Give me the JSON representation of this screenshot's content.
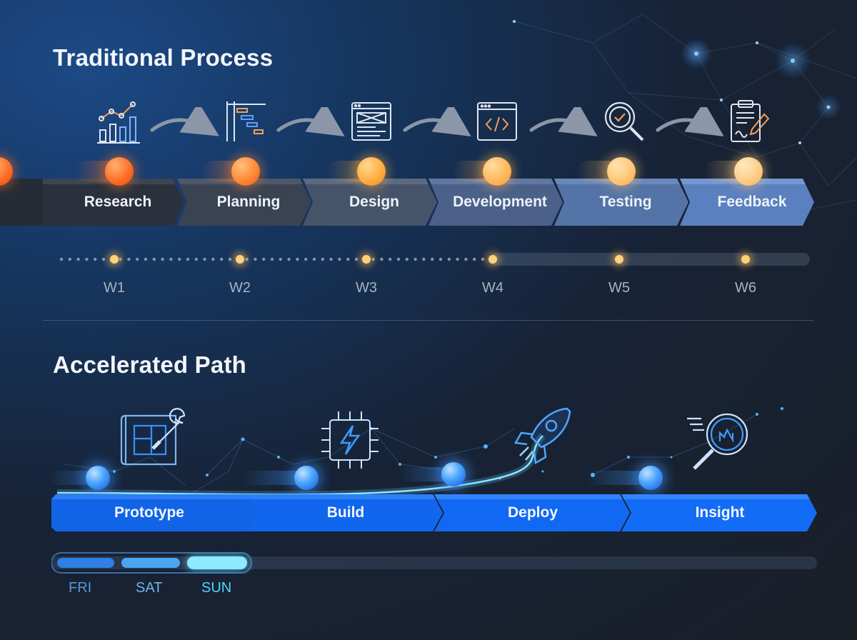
{
  "traditional": {
    "title": "Traditional Process",
    "steps": [
      {
        "label": "Research",
        "icon": "chart-icon"
      },
      {
        "label": "Planning",
        "icon": "gantt-icon"
      },
      {
        "label": "Design",
        "icon": "wireframe-icon"
      },
      {
        "label": "Development",
        "icon": "code-icon"
      },
      {
        "label": "Testing",
        "icon": "magnifier-check-icon"
      },
      {
        "label": "Feedback",
        "icon": "clipboard-icon"
      }
    ],
    "weeks": [
      "W1",
      "W2",
      "W3",
      "W4",
      "W5",
      "W6"
    ]
  },
  "accelerated": {
    "title": "Accelerated Path",
    "steps": [
      {
        "label": "Prototype",
        "icon": "blueprint-wrench-icon"
      },
      {
        "label": "Build",
        "icon": "chip-bolt-icon"
      },
      {
        "label": "Deploy",
        "icon": "rocket-icon"
      },
      {
        "label": "Insight",
        "icon": "magnifier-chart-icon"
      }
    ],
    "days": [
      "FRI",
      "SAT",
      "SUN"
    ]
  },
  "colors": {
    "orange_ball": "#ff7a2e",
    "yellow_ball": "#ffc66e",
    "blue_step": "#1166ee",
    "day_fri": "#5a95d8",
    "day_sat": "#6fb3e8",
    "day_sun": "#4fd6ff"
  }
}
